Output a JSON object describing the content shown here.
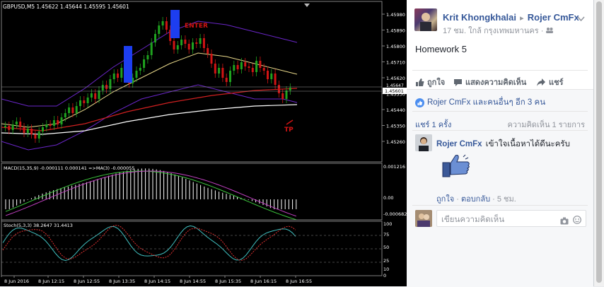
{
  "chart": {
    "header": "GBPUSD,M5  1.45622 1.45644 1.45595 1.45601",
    "price_ticks": [
      "1.45980",
      "1.45890",
      "1.45800",
      "1.45710",
      "1.45620",
      "1.45530",
      "1.45440",
      "1.45350",
      "1.45260"
    ],
    "current_price": "1.45601",
    "near_price": "1.45647",
    "enter_label": "ENTER",
    "tp_label": "TP",
    "macd_label": "MACD(15,35,9) -0.000111 0.000141  =>MA(3) -0.000055",
    "macd_ticks": [
      "0.001216",
      "0.00",
      "-0.000682"
    ],
    "stoch_label": "Stoch(5,3,3) 38.2647 31.4413",
    "stoch_ticks": [
      "100",
      "75",
      "50",
      "25",
      "10",
      "0"
    ],
    "time_ticks": [
      "8 Jun 2016",
      "8 Jun 12:15",
      "8 Jun 12:55",
      "8 Jun 13:35",
      "8 Jun 14:15",
      "8 Jun 14:55",
      "8 Jun 15:35",
      "8 Jun 16:15",
      "8 Jun 16:55"
    ],
    "colors": {
      "bull": "#1fa31f",
      "bear": "#d11414",
      "signal_box": "#1d3ef0",
      "bands": "#6a26c9"
    }
  },
  "post": {
    "author": "Krit Khongkhalai",
    "arrow": "▸",
    "group": "Rojer CmFx",
    "time": "17 ชม.",
    "location": "ใกล้ กรุงเทพมหานคร",
    "privacy_sep": "·",
    "body": "Homework 5",
    "actions": {
      "like": "ถูกใจ",
      "comment": "แสดงความคิดเห็น",
      "share": "แชร์"
    },
    "reactions": "Rojer CmFx และคนอื่นๆ อีก 3 คน",
    "shares": "แชร์ 1 ครั้ง",
    "comments_count": "ความคิดเห็น 1 รายการ"
  },
  "comment": {
    "author": "Rojer CmFx",
    "text": "เข้าใจเนื้อหาได้ดีนะครับ",
    "like": "ถูกใจ",
    "dot": "·",
    "reply": "ตอบกลับ",
    "time": "5 ชม."
  },
  "composer": {
    "placeholder": "เขียนความคิดเห็น"
  }
}
